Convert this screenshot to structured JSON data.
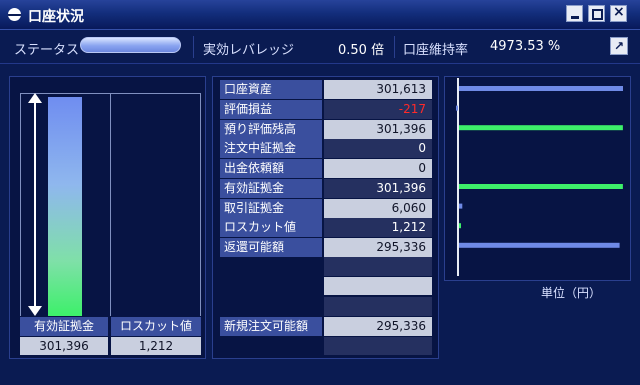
{
  "window": {
    "title": "口座状況"
  },
  "status": {
    "status_label": "ステータス",
    "leverage_label": "実効レバレッジ",
    "leverage_value": "0.50 倍",
    "maintenance_label": "口座維持率",
    "maintenance_value": "4973.53 %"
  },
  "gauge": {
    "columns": [
      {
        "header": "有効証拠金",
        "value": "301,396"
      },
      {
        "header": "ロスカット値",
        "value": "1,212"
      }
    ],
    "fill_ratio": 0.98
  },
  "table": {
    "rows": [
      {
        "label": "口座資産",
        "value": "301,613"
      },
      {
        "label": "評価損益",
        "value": "-217"
      },
      {
        "label": "預り評価残高",
        "value": "301,396"
      },
      {
        "label": "注文中証拠金",
        "value": "0"
      },
      {
        "label": "出金依頼額",
        "value": "0"
      },
      {
        "label": "有効証拠金",
        "value": "301,396"
      },
      {
        "label": "取引証拠金",
        "value": "6,060"
      },
      {
        "label": "ロスカット値",
        "value": "1,212"
      },
      {
        "label": "返還可能額",
        "value": "295,336"
      }
    ],
    "new_order": {
      "label": "新規注文可能額",
      "value": "295,336"
    }
  },
  "chart": {
    "unit_label": "単位（円）",
    "bars": [
      {
        "value": 301613,
        "color": "#6f8ae6"
      },
      {
        "value": -217,
        "color": "#6f8ae6"
      },
      {
        "value": 301396,
        "color": "#3df06a"
      },
      {
        "value": 0,
        "color": "#6f8ae6"
      },
      {
        "value": 0,
        "color": "#6f8ae6"
      },
      {
        "value": 301396,
        "color": "#3df06a"
      },
      {
        "value": 6060,
        "color": "#6f8ae6"
      },
      {
        "value": 1212,
        "color": "#3df06a"
      },
      {
        "value": 295336,
        "color": "#6f8ae6"
      }
    ]
  }
}
